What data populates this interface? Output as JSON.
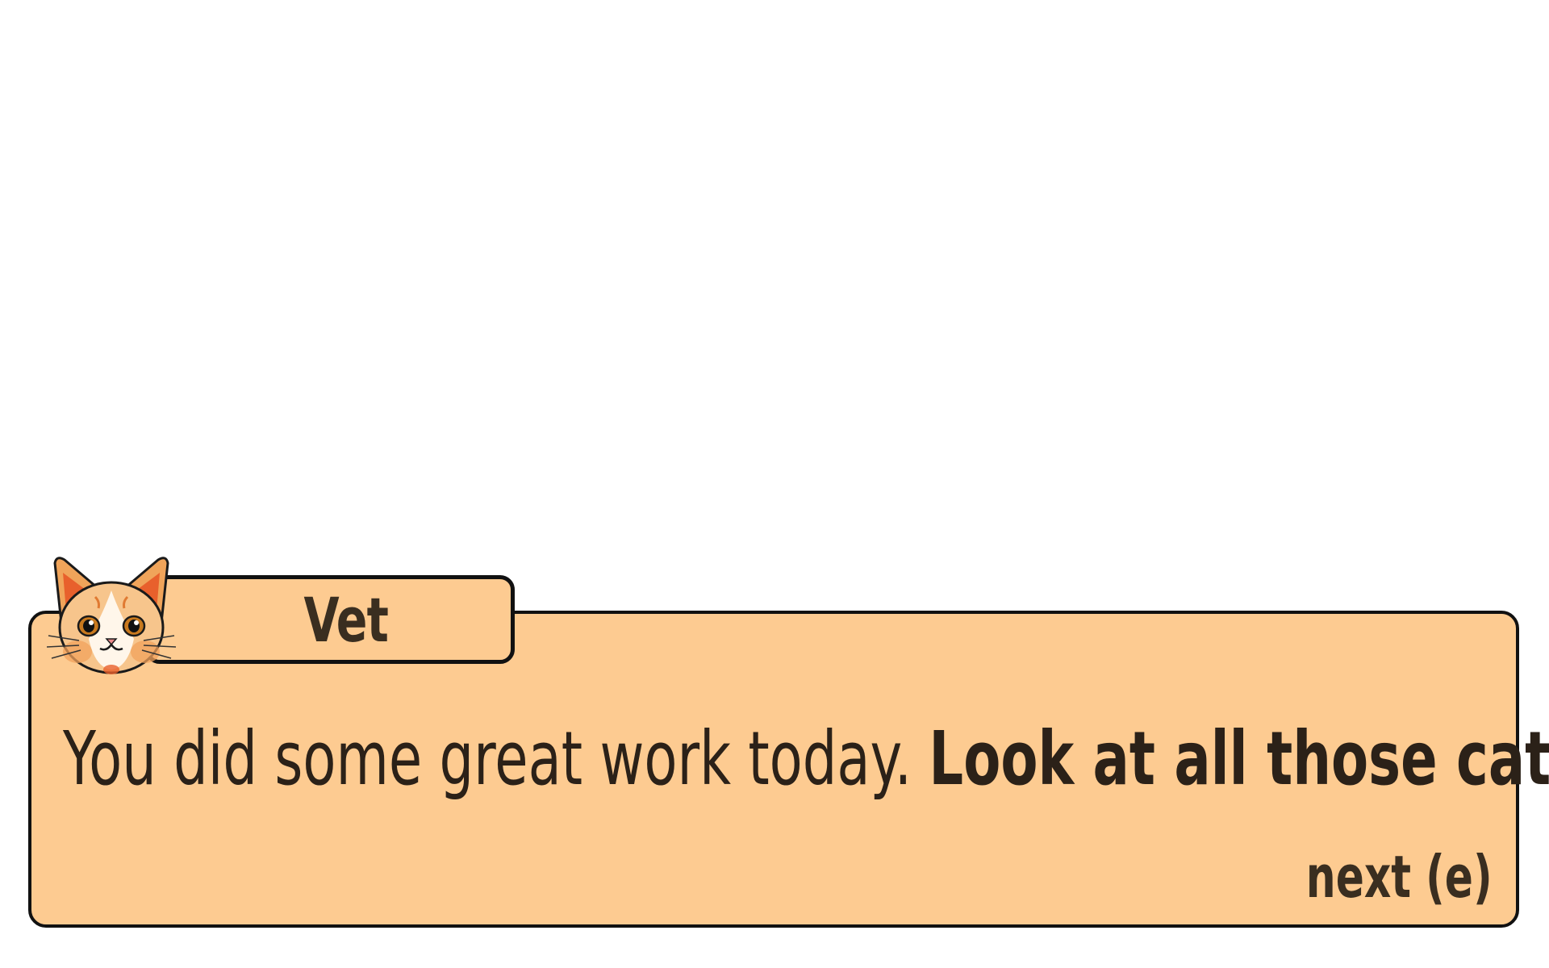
{
  "dialog": {
    "speaker": "Vet",
    "text_plain": "You did some great work today. ",
    "text_bold": "Look at all those cats!",
    "next_label": "next (e)"
  },
  "portrait": {
    "icon": "cat-face-icon"
  },
  "colors": {
    "box_fill": "#fdcb91",
    "border": "#111111",
    "text": "#2b2118"
  }
}
